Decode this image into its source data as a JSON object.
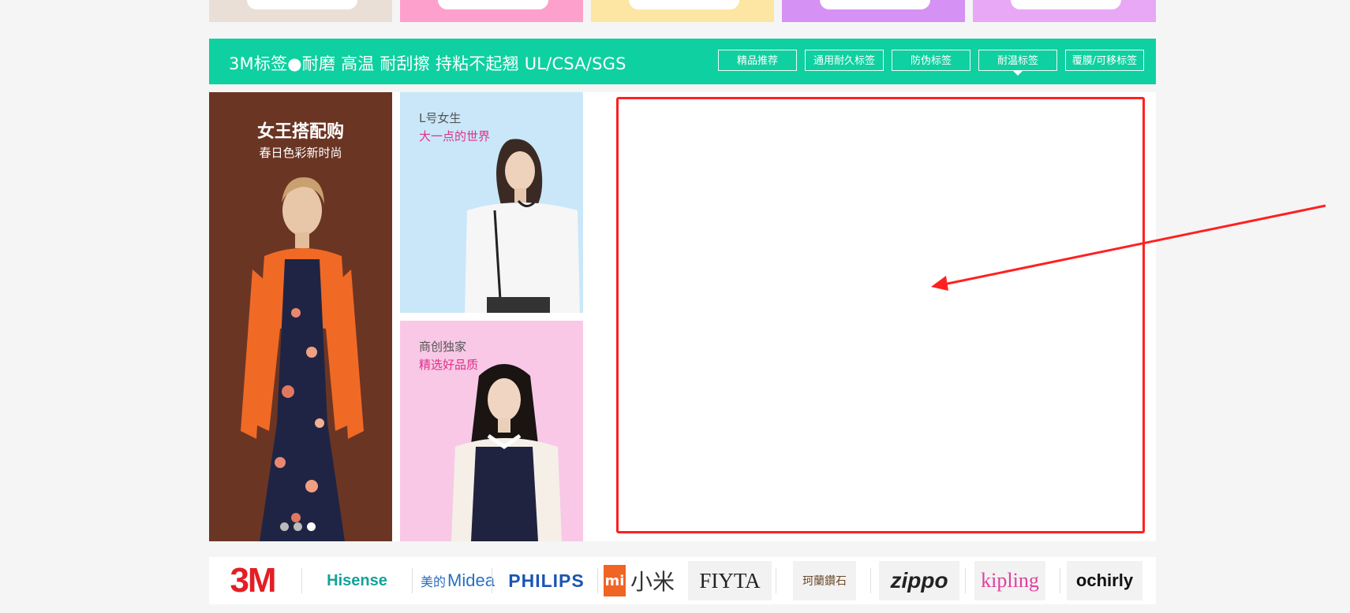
{
  "top_tiles": [
    {
      "color": "#eadfd6"
    },
    {
      "color": "#fda1cc"
    },
    {
      "color": "#fde5a4"
    },
    {
      "color": "#d691f4"
    },
    {
      "color": "#e8a8f6"
    }
  ],
  "section_header": {
    "title": "3M标签●耐磨 高温 耐刮擦 持粘不起翘 UL/CSA/SGS",
    "background": "#0fd0a0",
    "tabs": [
      {
        "label": "精品推荐",
        "active": false
      },
      {
        "label": "通用耐久标签",
        "active": false
      },
      {
        "label": "防伪标签",
        "active": false
      },
      {
        "label": "耐温标签",
        "active": true
      },
      {
        "label": "覆膜/可移标签",
        "active": false
      }
    ]
  },
  "banner_left": {
    "title": "女王搭配购",
    "subtitle": "春日色彩新时尚",
    "dots": 3,
    "active_dot": 3
  },
  "promos": [
    {
      "line1": "L号女生",
      "line2": "大一点的世界"
    },
    {
      "line1": "商创独家",
      "line2": "精选好品质"
    }
  ],
  "annotation": {
    "highlight_color": "#ff2020"
  },
  "brands": [
    {
      "name": "3M"
    },
    {
      "name": "Hisense"
    },
    {
      "name": "美的",
      "name2": "Midea"
    },
    {
      "name": "PHILIPS"
    },
    {
      "name": "mi",
      "name2": "小米"
    },
    {
      "name": "FIYTA"
    },
    {
      "name": "珂蘭鑽石"
    },
    {
      "name": "zippo"
    },
    {
      "name": "kipling"
    },
    {
      "name": "ochirly"
    }
  ]
}
